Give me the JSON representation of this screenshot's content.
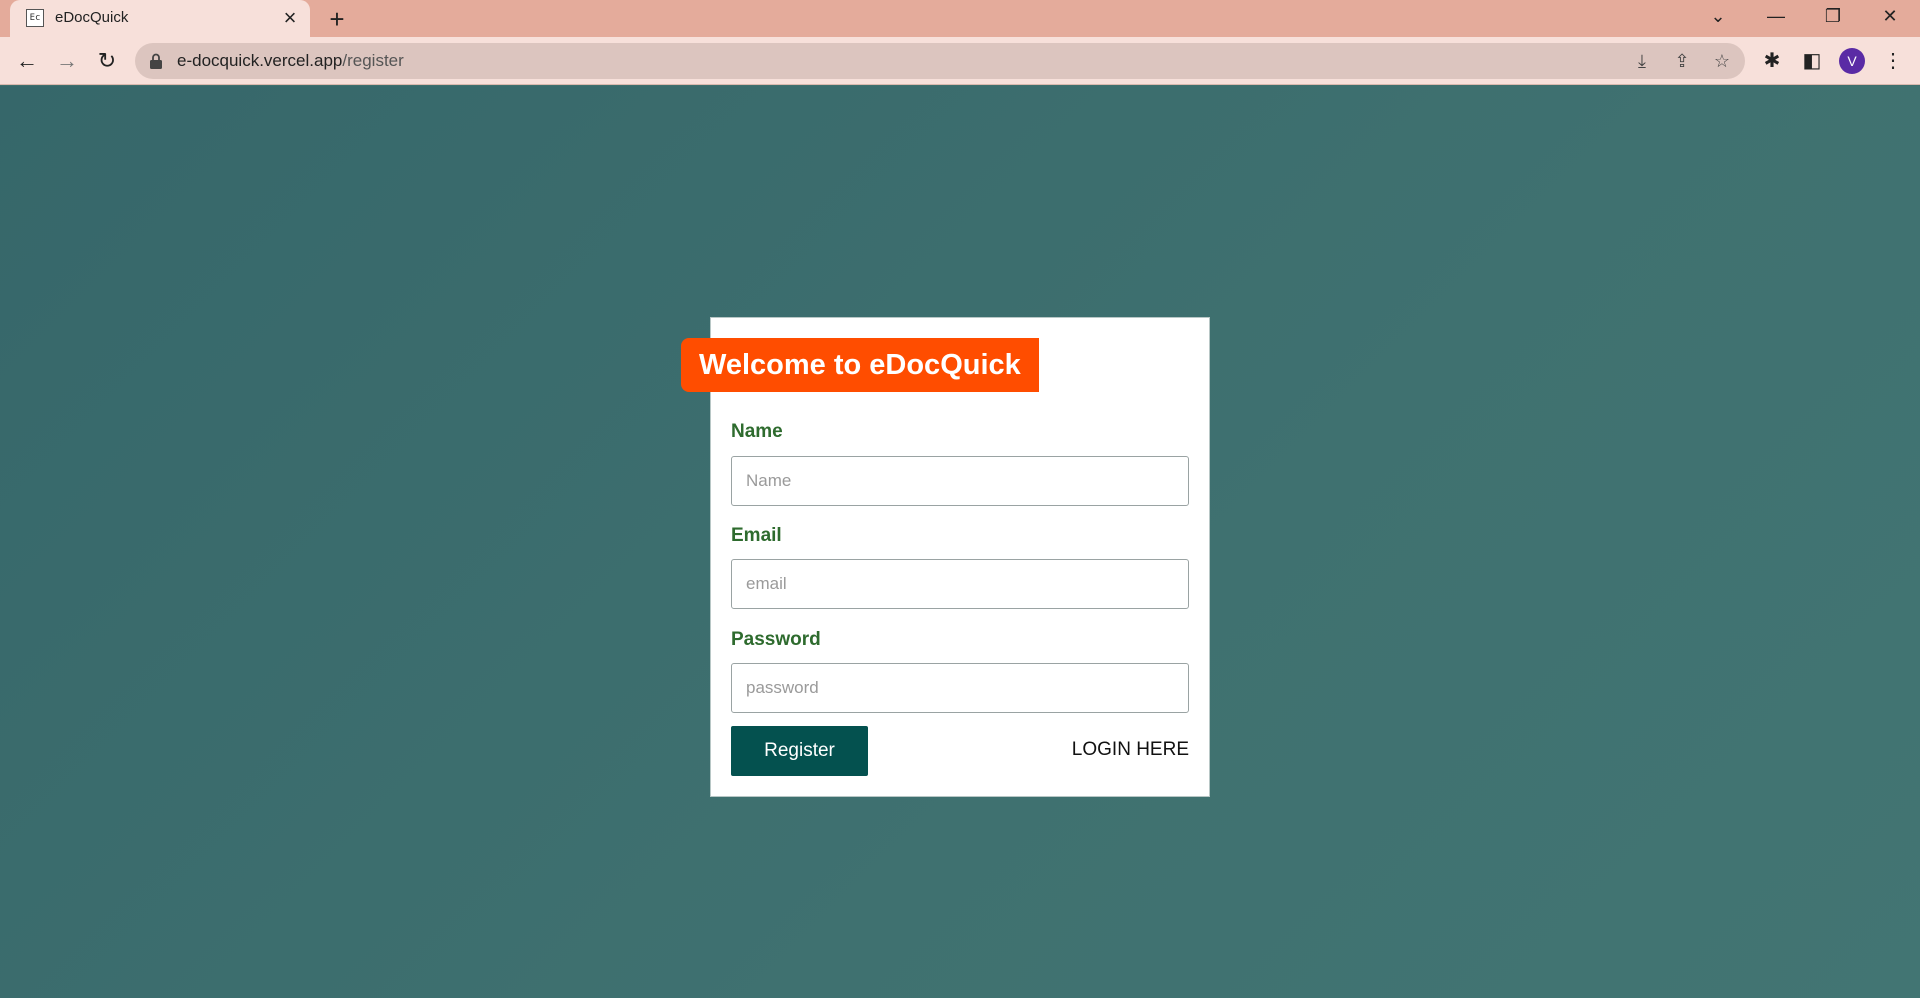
{
  "browser": {
    "tab_title": "eDocQuick",
    "tab_favicon_text": "Ec",
    "url_host": "e-docquick.vercel.app",
    "url_path": "/register",
    "profile_initial": "V"
  },
  "form": {
    "banner": "Welcome to eDocQuick",
    "name_label": "Name",
    "name_placeholder": "Name",
    "email_label": "Email",
    "email_placeholder": "email",
    "password_label": "Password",
    "password_placeholder": "password",
    "register_button": "Register",
    "login_link": "LOGIN HERE"
  },
  "colors": {
    "background": "#3f6f6d",
    "banner": "#ff4d00",
    "button": "#04514f",
    "label": "#2e6b2e"
  }
}
